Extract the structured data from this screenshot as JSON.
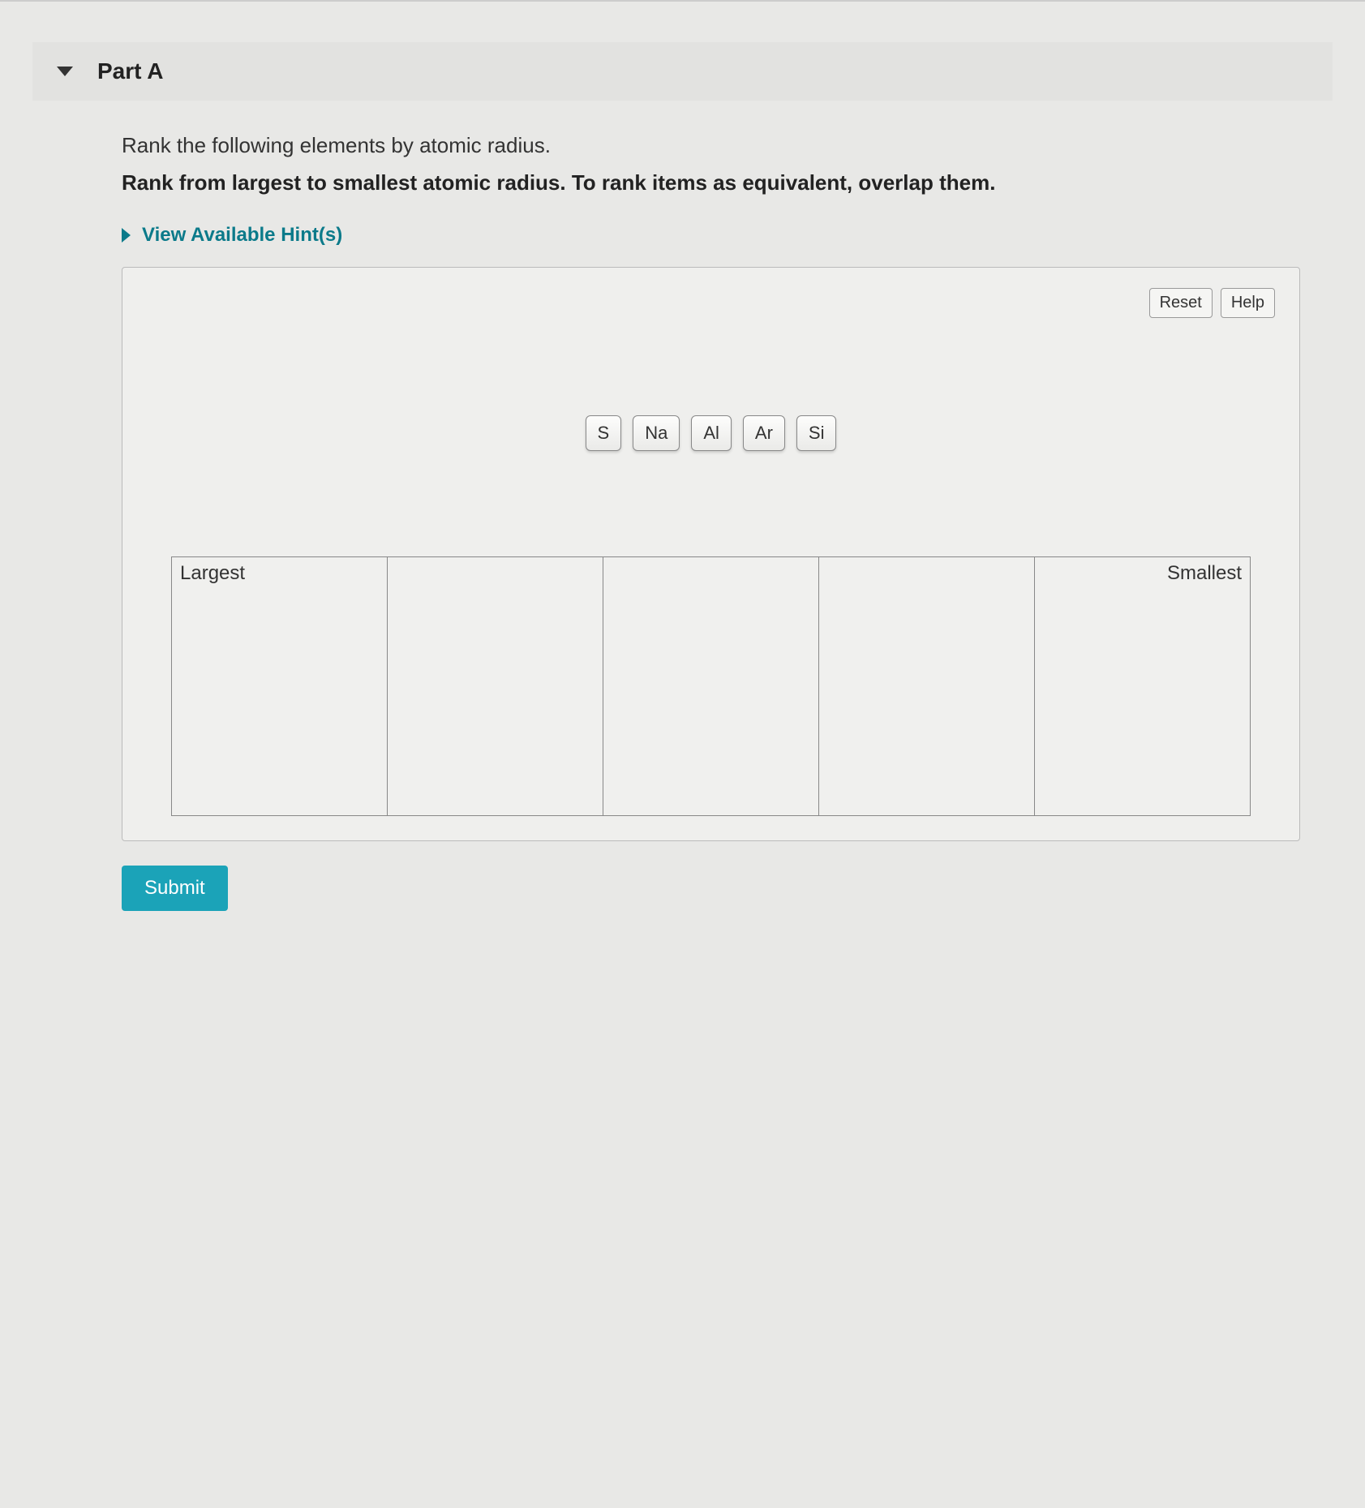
{
  "part": {
    "title": "Part A"
  },
  "prompt": {
    "line1": "Rank the following elements by atomic radius.",
    "line2": "Rank from largest to smallest atomic radius. To rank items as equivalent, overlap them."
  },
  "hints": {
    "label": "View Available Hint(s)"
  },
  "buttons": {
    "reset": "Reset",
    "help": "Help",
    "submit": "Submit"
  },
  "elements": {
    "e0": "S",
    "e1": "Na",
    "e2": "Al",
    "e3": "Ar",
    "e4": "Si"
  },
  "ranking": {
    "left_label": "Largest",
    "right_label": "Smallest",
    "slots": 5
  }
}
